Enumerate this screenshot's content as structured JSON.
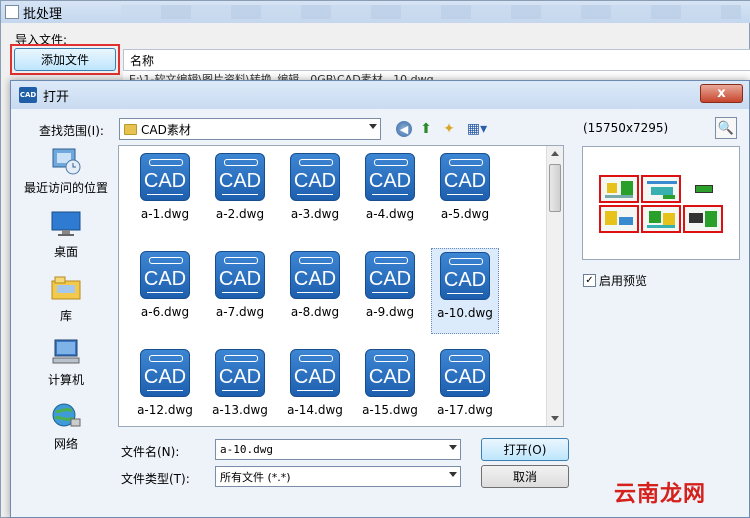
{
  "batch_window": {
    "title": "批处理",
    "import_label": "导入文件:",
    "add_file_button": "添加文件",
    "column_name": "名称",
    "row_path": "E:\\1-软文编辑\\图片资料\\转换_编辑__0GB\\CAD素材...10.dwg"
  },
  "dialog": {
    "title": "打开",
    "look_in_label": "查找范围(I):",
    "look_in_value": "CAD素材",
    "close_label": "x",
    "places": [
      {
        "label": "最近访问的位置",
        "icon": "recent-places-icon"
      },
      {
        "label": "桌面",
        "icon": "desktop-icon"
      },
      {
        "label": "库",
        "icon": "libraries-icon"
      },
      {
        "label": "计算机",
        "icon": "computer-icon"
      },
      {
        "label": "网络",
        "icon": "network-icon"
      }
    ],
    "files": [
      {
        "name": "a-1.dwg"
      },
      {
        "name": "a-2.dwg"
      },
      {
        "name": "a-3.dwg"
      },
      {
        "name": "a-4.dwg"
      },
      {
        "name": "a-5.dwg"
      },
      {
        "name": "a-6.dwg"
      },
      {
        "name": "a-7.dwg"
      },
      {
        "name": "a-8.dwg"
      },
      {
        "name": "a-9.dwg"
      },
      {
        "name": "a-10.dwg"
      },
      {
        "name": "a-12.dwg"
      },
      {
        "name": "a-13.dwg"
      },
      {
        "name": "a-14.dwg"
      },
      {
        "name": "a-15.dwg"
      },
      {
        "name": "a-17.dwg"
      }
    ],
    "selected_file": "a-10.dwg",
    "icon_text": "CAD",
    "preview_dims": "(15750x7295)",
    "enable_preview_label": "启用预览",
    "enable_preview_checked": "✓",
    "file_name_label": "文件名(N):",
    "file_name_value": "a-10.dwg",
    "file_type_label": "文件类型(T):",
    "file_type_value": "所有文件 (*.*)",
    "open_button": "打开(O)",
    "cancel_button": "取消"
  },
  "watermark": "云南龙网",
  "colors": {
    "highlight_border": "#e03030",
    "cad_icon_blue": "#2a6fc0",
    "watermark_red": "#d6201b"
  }
}
